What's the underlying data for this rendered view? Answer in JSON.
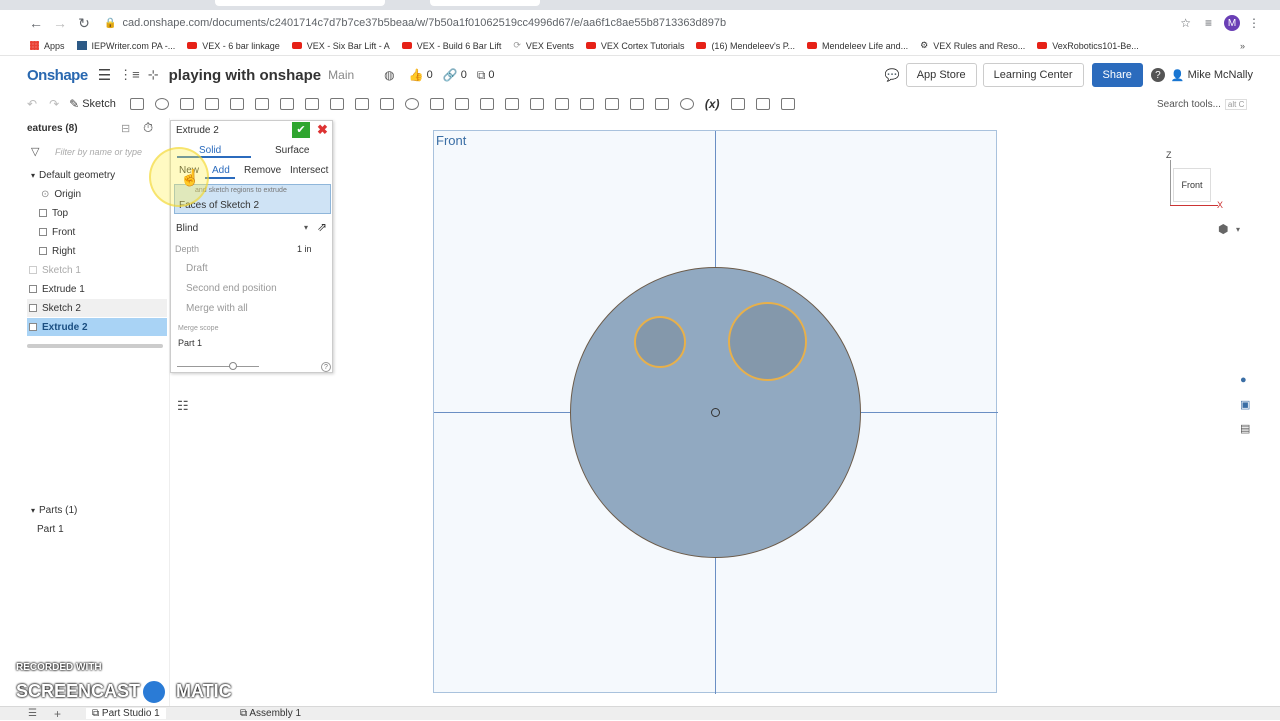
{
  "browser": {
    "url": "cad.onshape.com/documents/c2401714c7d7b7ce37b5beaa/w/7b50a1f01062519cc4996d67/e/aa6f1c8ae55b8713363d897b",
    "profile_initial": "M",
    "bookmarks": [
      "Apps",
      "IEPWriter.com PA -...",
      "VEX - 6 bar linkage",
      "VEX - Six Bar Lift - A",
      "VEX - Build 6 Bar Lift",
      "VEX Events",
      "VEX Cortex Tutorials",
      "(16) Mendeleev's P...",
      "Mendeleev Life and...",
      "VEX Rules and Reso...",
      "VexRobotics101-Be..."
    ]
  },
  "header": {
    "logo": "Onshape",
    "doc_title": "playing with onshape",
    "branch": "Main",
    "likes": "0",
    "links": "0",
    "versions": "0",
    "app_store": "App Store",
    "learning_center": "Learning Center",
    "share": "Share",
    "help": "?",
    "user": "Mike McNally"
  },
  "toolbar": {
    "sketch_label": "Sketch",
    "search_placeholder": "Search tools...",
    "search_shortcut": "alt C"
  },
  "feature_tree": {
    "title": "eatures (8)",
    "filter_placeholder": "Filter by name or type",
    "default_geometry": "Default geometry",
    "items": [
      {
        "label": "Origin"
      },
      {
        "label": "Top"
      },
      {
        "label": "Front"
      },
      {
        "label": "Right"
      },
      {
        "label": "Sketch 1"
      },
      {
        "label": "Extrude 1"
      },
      {
        "label": "Sketch 2"
      },
      {
        "label": "Extrude 2"
      }
    ],
    "parts_header": "Parts (1)",
    "part": "Part 1"
  },
  "dialog": {
    "title": "Extrude 2",
    "tab_solid": "Solid",
    "tab_surface": "Surface",
    "ops": [
      "New",
      "Add",
      "Remove",
      "Intersect"
    ],
    "hint": "and sketch regions to extrude",
    "selection": "Faces of Sketch 2",
    "end_type": "Blind",
    "depth_label": "Depth",
    "depth_value": "1 in",
    "draft": "Draft",
    "second_end": "Second end position",
    "merge_all": "Merge with all",
    "merge_scope_label": "Merge scope",
    "merge_scope_value": "Part 1"
  },
  "viewport": {
    "plane_label": "Front",
    "cube_label": "Front",
    "axis_z": "Z",
    "axis_x": "X"
  },
  "bottom_tabs": [
    "Part Studio 1",
    "Assembly 1"
  ],
  "watermark": {
    "recorded_with": "RECORDED WITH",
    "brand": "SCREENCAST",
    "brand2": "MATIC"
  },
  "colors": {
    "accent": "#2b6bbd",
    "selected": "#a9d3f5",
    "part_fill": "#91a9c1",
    "highlight": "#e8b04a"
  }
}
